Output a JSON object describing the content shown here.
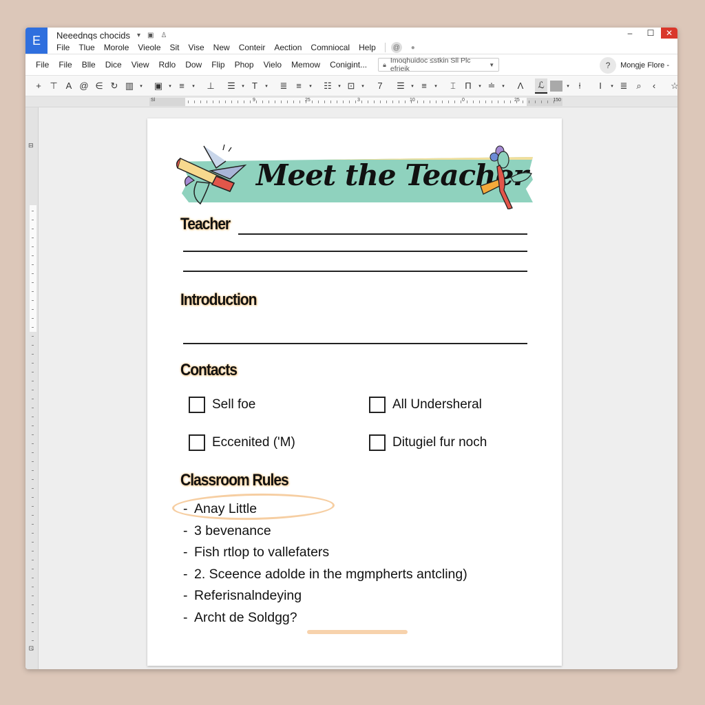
{
  "window": {
    "app_logo": "E",
    "doc_title": "Neeednqs chocids",
    "title_icons": [
      "dropdown-caret-icon",
      "folder-icon",
      "person-icon"
    ],
    "controls": {
      "minimize": "–",
      "maximize": "☐",
      "close": "✕"
    }
  },
  "menubar": {
    "items": [
      "File",
      "Tlue",
      "Morole",
      "Vieole",
      "Sit",
      "Vise",
      "New",
      "Conteir",
      "Aection",
      "Comniocal",
      "Help"
    ],
    "right_icons": [
      "at-sign-icon",
      "settings-icon"
    ]
  },
  "menubar2": {
    "items": [
      "File",
      "File",
      "Blle",
      "Dice",
      "View",
      "Rdlo",
      "Dow",
      "Flip",
      "Phop",
      "Vielo",
      "Memow",
      "Conigint..."
    ],
    "dropdown": {
      "value": "Imoqhuidoc ≤stkin Sll Plc efrieik"
    },
    "user": {
      "name": "Mongje Flore -"
    }
  },
  "toolbar": {
    "items": [
      {
        "glyph": "+",
        "name": "add-icon"
      },
      {
        "glyph": "⊤",
        "name": "insert-icon"
      },
      {
        "glyph": "A",
        "name": "font-icon"
      },
      {
        "glyph": "@",
        "name": "mention-icon"
      },
      {
        "glyph": "∈",
        "name": "undo-icon"
      },
      {
        "glyph": "↻",
        "name": "redo-icon"
      },
      {
        "glyph": "▥",
        "name": "table-icon",
        "caret": true
      },
      {
        "glyph": "▣",
        "name": "image-icon",
        "caret": true
      },
      {
        "glyph": "≡",
        "name": "paragraph-style-icon",
        "caret": true
      },
      {
        "glyph": "⊥",
        "name": "align-bottom-icon"
      },
      {
        "glyph": "☰",
        "name": "list-icon",
        "caret": true
      },
      {
        "glyph": "T",
        "name": "text-style-icon",
        "caret": true
      },
      {
        "glyph": "≣",
        "name": "align-justify-icon"
      },
      {
        "glyph": "≡",
        "name": "align-left-icon",
        "caret": true
      },
      {
        "glyph": "☷",
        "name": "columns-icon",
        "caret": true
      },
      {
        "glyph": "⊡",
        "name": "frame-icon",
        "caret": true
      },
      {
        "glyph": "7",
        "name": "format-icon"
      },
      {
        "glyph": "☰",
        "name": "bullets-icon",
        "caret": true
      },
      {
        "glyph": "≡",
        "name": "numbering-icon",
        "caret": true
      },
      {
        "glyph": "⌶",
        "name": "text-color-icon"
      },
      {
        "glyph": "Π",
        "name": "spacing-icon",
        "caret": true
      },
      {
        "glyph": "≐",
        "name": "strikethrough-icon",
        "caret": true
      },
      {
        "glyph": "Λ",
        "name": "caret-up-icon"
      },
      {
        "glyph": "ℒ",
        "name": "highlight-icon",
        "active": true
      },
      {
        "glyph": "",
        "name": "fill-color-icon",
        "gray": true,
        "caret": true
      },
      {
        "glyph": "⍿",
        "name": "border-icon"
      },
      {
        "glyph": "I",
        "name": "italic-icon",
        "caret": true
      },
      {
        "glyph": "≣",
        "name": "indent-icon"
      },
      {
        "glyph": "⌕",
        "name": "search-icon"
      },
      {
        "glyph": "‹",
        "name": "back-icon"
      },
      {
        "glyph": "☆",
        "name": "star-icon"
      },
      {
        "glyph": "▼",
        "name": "collapse-icon"
      },
      {
        "glyph": "⋮",
        "name": "more-icon"
      }
    ]
  },
  "ruler": {
    "start_label": "Sl",
    "end_label": "150",
    "numbers": [
      "9",
      "25",
      "3",
      "10",
      "0",
      "25"
    ]
  },
  "document": {
    "banner_title": "Meet the Teacher",
    "sections": {
      "teacher": "Teacher",
      "introduction": "Introduction",
      "contacts": "Contacts",
      "classroom_rules": "Classroom Rules"
    },
    "contacts": [
      {
        "label": "Sell foe",
        "checked": false
      },
      {
        "label": "All Undersheral",
        "checked": false
      },
      {
        "label": "Eccenited ('M)",
        "checked": false
      },
      {
        "label": "Ditugiel fur noch",
        "checked": false
      }
    ],
    "rules": [
      "Anay Little",
      "3 bevenance",
      "Fish rtlop to vallefaters",
      "2. Sceence adolde in the mgmpherts antcling)",
      "Referisnalndeying",
      "Archt de Soldgg?"
    ],
    "rule_bullet": "-"
  },
  "colors": {
    "app_accent": "#2f6fde",
    "close_button": "#d9372b",
    "banner_teal": "#8fd2be",
    "banner_yellow": "#f1df9c",
    "heading_glow": "#f6cf99",
    "background": "#dcc7b9"
  }
}
